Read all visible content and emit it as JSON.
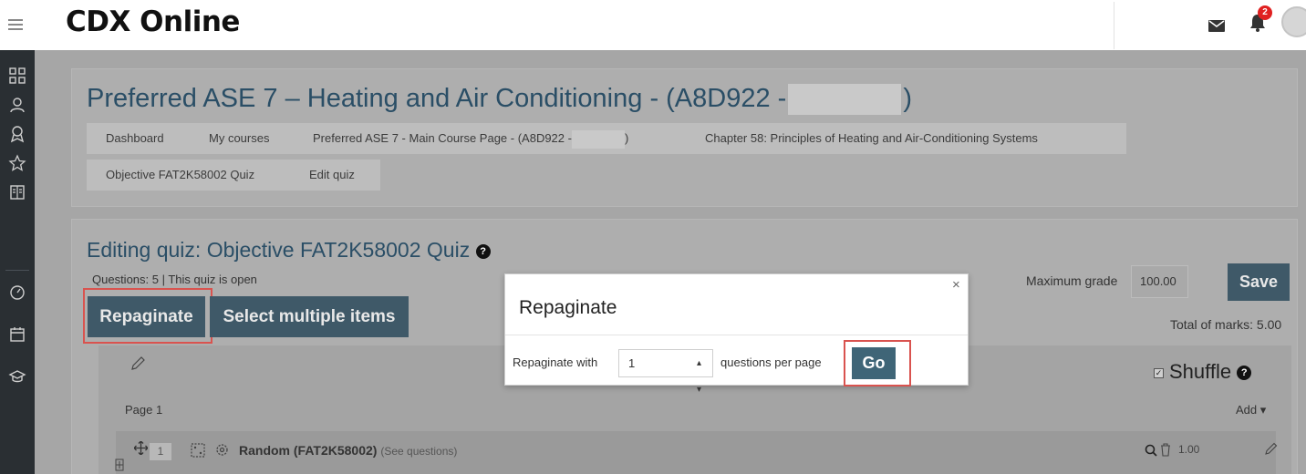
{
  "navbar": {
    "brand": "CDX Online",
    "notification_count": "2"
  },
  "course": {
    "title_prefix": "Preferred ASE 7 – Heating and Air Conditioning - (A8D922 -",
    "title_suffix": ")"
  },
  "breadcrumb": {
    "items": [
      "Dashboard",
      "My courses",
      "Preferred ASE 7 - Main Course Page - (A8D922 -",
      "Chapter 58: Principles of Heating and Air-Conditioning Systems",
      "Objective FAT2K58002 Quiz",
      "Edit quiz"
    ],
    "item3_suffix": ")"
  },
  "quiz": {
    "title": "Editing quiz: Objective FAT2K58002 Quiz",
    "status": "Questions: 5 | This quiz is open",
    "repaginate_label": "Repaginate",
    "select_multiple_label": "Select multiple items",
    "max_grade_label": "Maximum grade",
    "max_grade_value": "100.00",
    "save_label": "Save",
    "total_marks": "Total of marks: 5.00",
    "shuffle_label": "Shuffle",
    "page_label": "Page 1",
    "add_label": "Add",
    "slot": {
      "number": "1",
      "title": "Random (FAT2K58002)",
      "subtitle": "(See questions)",
      "mark": "1.00"
    }
  },
  "modal": {
    "title": "Repaginate",
    "close": "×",
    "label_before": "Repaginate with",
    "select_value": "1",
    "label_after": "questions per page",
    "go_label": "Go"
  },
  "colors": {
    "accent": "#3f5968",
    "title": "#2a4e66",
    "highlight": "#d9534f",
    "badge": "#e02020"
  }
}
